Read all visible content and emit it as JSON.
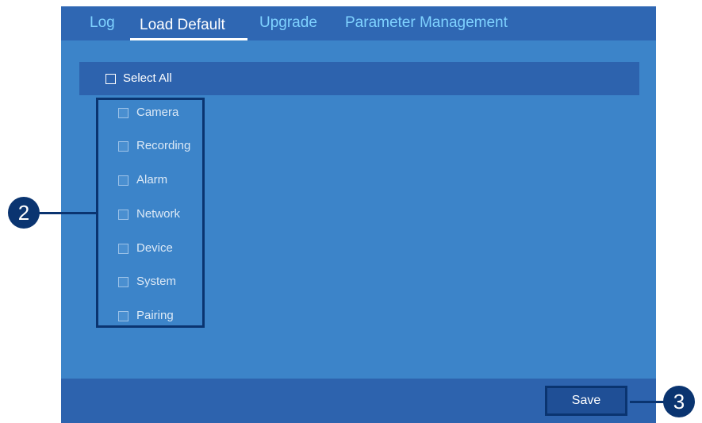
{
  "tabs": [
    {
      "label": "Log",
      "active": false
    },
    {
      "label": "Load Default",
      "active": true
    },
    {
      "label": "Upgrade",
      "active": false
    },
    {
      "label": "Parameter Management",
      "active": false
    }
  ],
  "select_all": {
    "label": "Select All",
    "checked": false
  },
  "options": [
    {
      "label": "Camera",
      "checked": false
    },
    {
      "label": "Recording",
      "checked": false
    },
    {
      "label": "Alarm",
      "checked": false
    },
    {
      "label": "Network",
      "checked": false
    },
    {
      "label": "Device",
      "checked": false
    },
    {
      "label": "System",
      "checked": false
    },
    {
      "label": "Pairing",
      "checked": false
    }
  ],
  "footer": {
    "save_label": "Save"
  },
  "callouts": {
    "left_badge": "2",
    "right_badge": "3"
  },
  "colors": {
    "panel_bg": "#3c84c9",
    "bar_bg": "#2d63ae",
    "tab_inactive": "#7fd2ff",
    "callout": "#0a3470"
  }
}
